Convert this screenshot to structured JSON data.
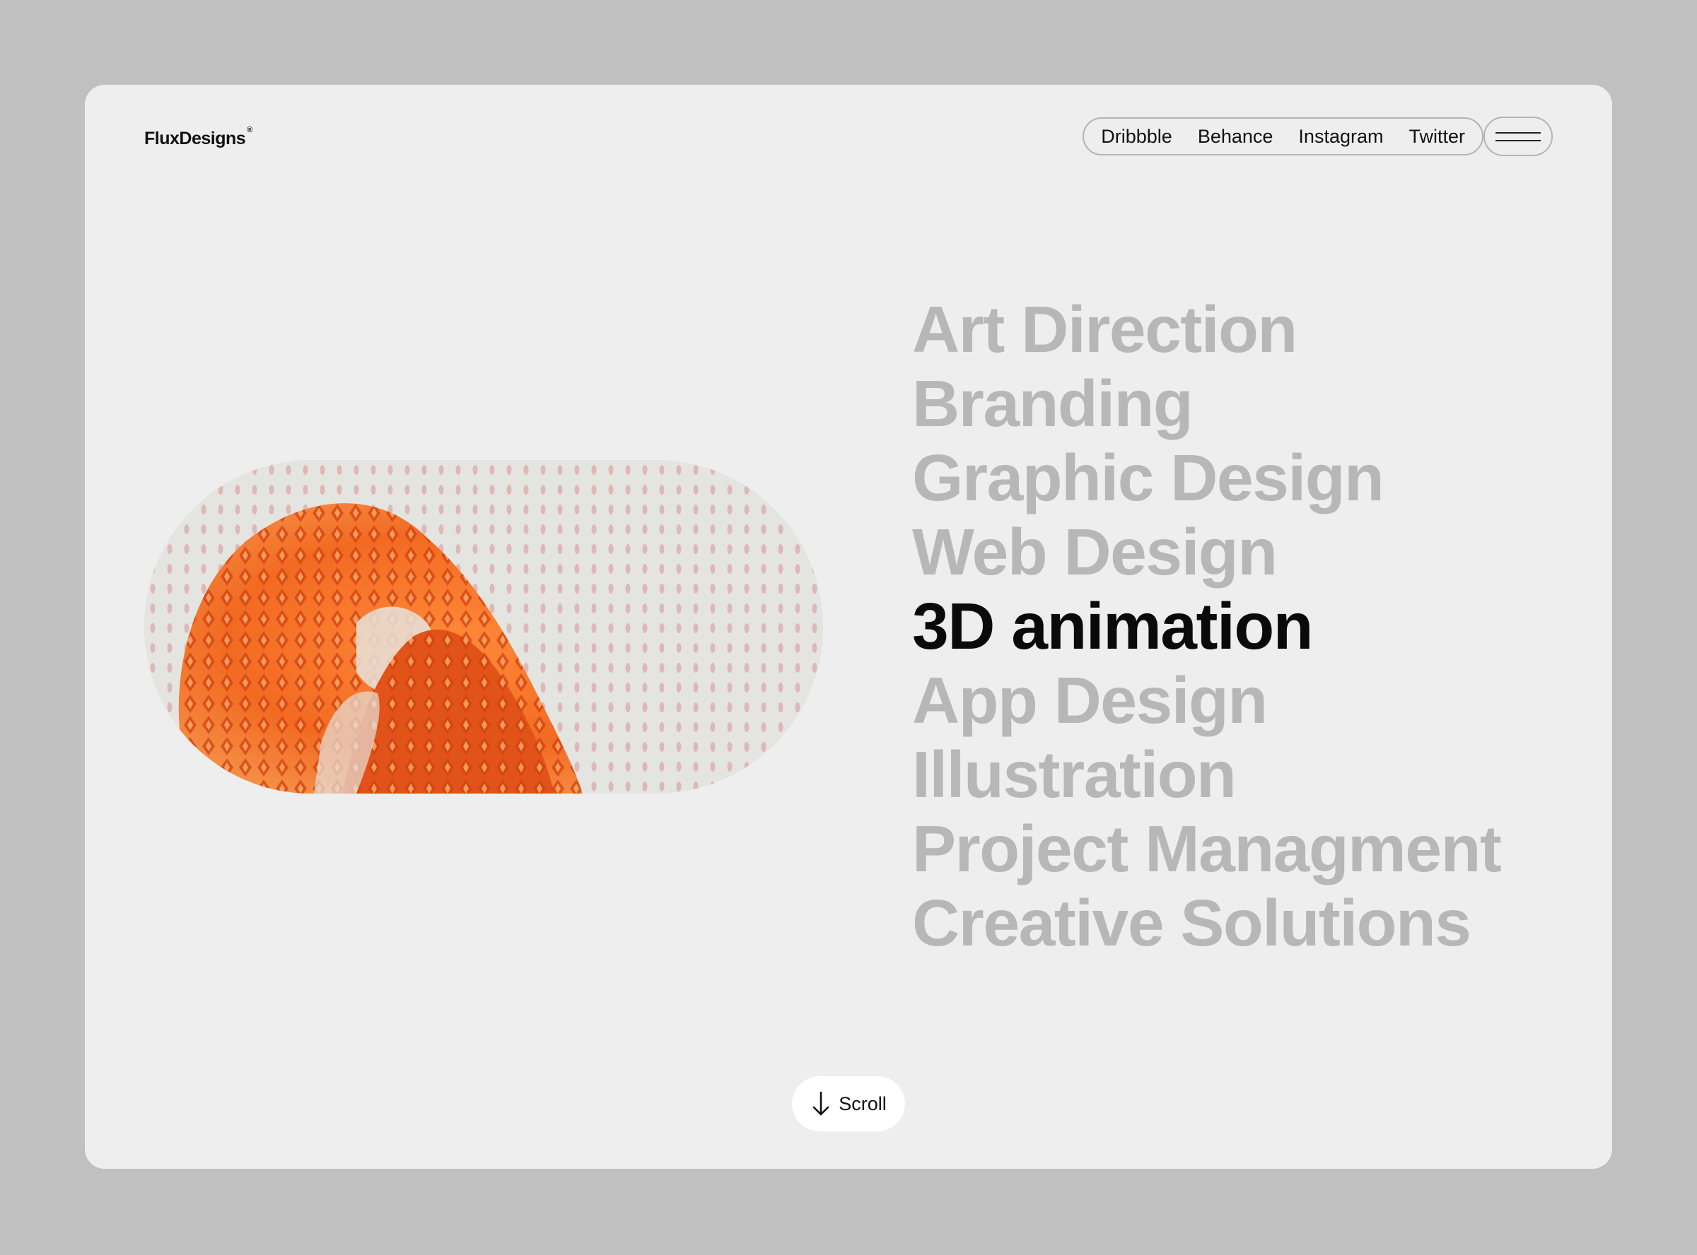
{
  "brand": {
    "name": "FluxDesigns",
    "registered_mark": "®"
  },
  "nav": {
    "links": [
      "Dribbble",
      "Behance",
      "Instagram",
      "Twitter"
    ],
    "menu_icon": "hamburger-icon"
  },
  "services": {
    "items": [
      "Art Direction",
      "Branding",
      "Graphic Design",
      "Web Design",
      "3D animation",
      "App Design",
      "Illustration",
      "Project Managment",
      "Creative Solutions"
    ],
    "active_index": 4
  },
  "scroll": {
    "label": "Scroll",
    "icon": "arrow-down-icon"
  },
  "colors": {
    "page_bg": "#c0c0c0",
    "card_bg": "#eeeeee",
    "inactive_text": "#b7b7b7",
    "active_text": "#0a0a0a",
    "accent_orange": "#f06a1f"
  }
}
